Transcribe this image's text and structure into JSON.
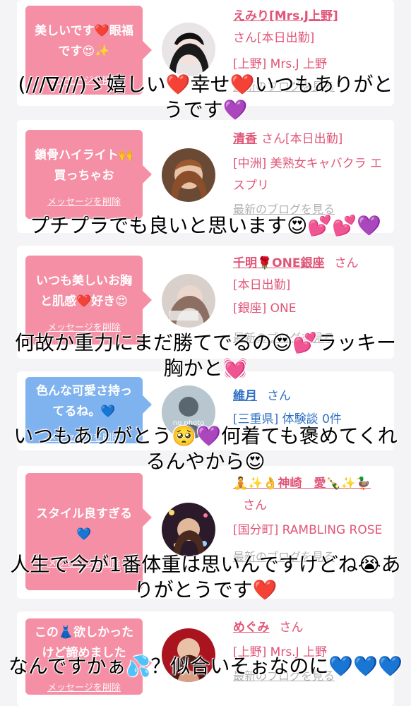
{
  "cards": [
    {
      "message": "美しいです❤️眼福です😍✨",
      "delete_label": "メッセージを削除",
      "name": "えみり[Mrs.J上野]",
      "san": "さん[本日出勤]",
      "shop": "[上野] Mrs.J 上野",
      "blog": "最新のブログを見る",
      "bubble_color": "#f58fa5"
    },
    {
      "message": "鎖骨ハイライト🙌買っちゃお",
      "delete_label": "メッセージを削除",
      "name": "清香",
      "san": "さん[本日出勤]",
      "shop": "[中洲] 美熟女キャバクラ エスプリ",
      "blog": "最新のブログを見る",
      "bubble_color": "#f58fa5"
    },
    {
      "message": "いつも美しいお胸と肌感❤️好き😍",
      "delete_label": "メッセージを削除",
      "name": "千明🌹ONE銀座",
      "san": "さん",
      "status": "[本日出勤]",
      "shop": "[銀座] ONE",
      "blog": "最新のブログを見る",
      "bubble_color": "#f58fa5"
    },
    {
      "message": "色んな可愛さ持ってるね。💙",
      "delete_label": "メッセージを削除",
      "name": "維月",
      "san": "さん",
      "shop": "[三重県] 体験談 0件",
      "avatar_text": "no photo",
      "bubble_color": "#7fb3f0"
    },
    {
      "message": "スタイル良すぎる💙",
      "delete_label": "メッセージを削除",
      "name": "🧘✨👌神崎　愛🍾✨🦆",
      "san": "さん",
      "shop": "[国分町] RAMBLING ROSE",
      "blog": "最新のブログを見る",
      "bubble_color": "#f58fa5"
    },
    {
      "message": "この👗欲しかったけど諦めました",
      "delete_label": "メッセージを削除",
      "name": "めぐみ",
      "san": "さん",
      "shop": "[上野] Mrs.J 上野",
      "blog": "最新のブログを見る",
      "bubble_color": "#f58fa5"
    }
  ],
  "captions": [
    "(///∇///)ゞ嬉しい❤️幸せ❤️いつもありがとうです💜",
    "プチプラでも良いと思います😍💕💕💜",
    "何故か重力にまだ勝てでるの😍💕ラッキー胸かと💓",
    "いつもありがとう🥺💜何着ても褒めてくれるんやから😍",
    "人生で今が1番体重は思いんですけどね😭ありがとうです❤️",
    "なんですかぁ💦？似合いそぉなのに💙💙💙"
  ]
}
